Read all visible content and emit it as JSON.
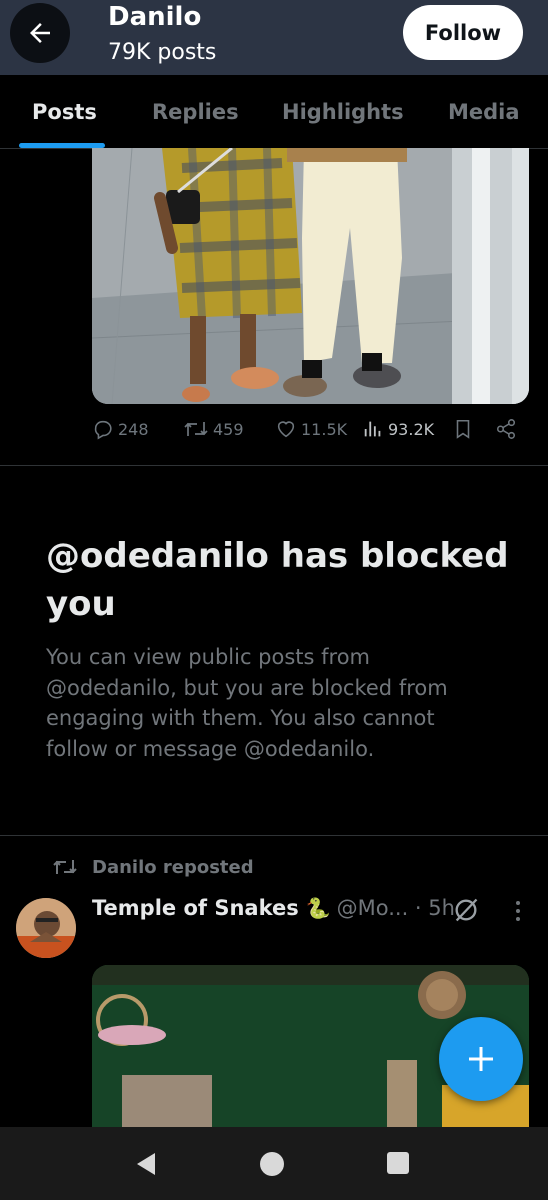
{
  "header": {
    "title": "Danilo",
    "subtitle": "79K posts",
    "follow_label": "Follow"
  },
  "tabs": [
    {
      "label": "Posts",
      "active": true
    },
    {
      "label": "Replies",
      "active": false
    },
    {
      "label": "Highlights",
      "active": false
    },
    {
      "label": "Media",
      "active": false
    }
  ],
  "post1": {
    "stats": {
      "replies": "248",
      "reposts": "459",
      "likes": "11.5K",
      "views": "93.2K"
    }
  },
  "blocked": {
    "title": "@odedanilo has blocked you",
    "body": "You can view public posts from @odedanilo, but you are blocked from engaging with them. You also cannot follow or message @odedanilo."
  },
  "post2": {
    "repost_label": "Danilo reposted",
    "author": "Temple of Snakes",
    "author_emoji": "🐍",
    "handle": "@Mo... · 5h"
  },
  "icons": {
    "back": "arrow-left-icon",
    "reply": "speech-bubble-icon",
    "repost": "repost-arrows-icon",
    "like": "heart-icon",
    "views": "bar-chart-icon",
    "bookmark": "bookmark-icon",
    "share": "share-icon",
    "grok": "grok-icon",
    "more": "more-vertical-icon",
    "compose": "plus-icon"
  },
  "colors": {
    "accent": "#1d9bf0",
    "header_bg": "#2c3444",
    "text_primary": "#e7e9ea",
    "text_secondary": "#71767b",
    "background": "#000000"
  }
}
